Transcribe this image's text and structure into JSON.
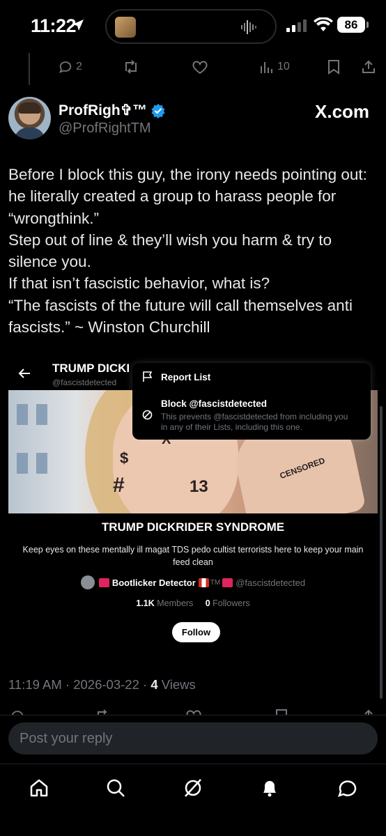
{
  "status_bar": {
    "time": "11:22",
    "battery": "86"
  },
  "prev_tweet_actions": {
    "replies": "2",
    "views": "10"
  },
  "author": {
    "display_name": "ProfRigh✞™",
    "handle": "@ProfRightTM"
  },
  "source_watermark": "X.com",
  "tweet": {
    "text": "Before I block this guy, the irony needs pointing out: he literally created a group to harass people for “wrongthink.”\nStep out of line & they’ll wish you harm & try to silence you.\nIf that isn’t fascistic behavior, what is?\n“The fascists of the future will call themselves anti fascists.” ~ Winston Churchill",
    "timestamp": "11:19 AM · 2026-03-22 · ",
    "views_count": "4",
    "views_label": " Views"
  },
  "embedded_list": {
    "header_title": "TRUMP DICKRIDER SYNDROME",
    "header_handle": "@fascistdetected",
    "menu": {
      "report_label": "Report List",
      "block_label": "Block @fascistdetected",
      "block_description": "This prevents @fascistdetected from including you in any of their Lists, including this one."
    },
    "name": "TRUMP DICKRIDER SYNDROME",
    "description": "Keep eyes on these mentally ill magat TDS pedo cultist terrorists here to keep your main feed clean",
    "owner_name": "Bootlicker Detector",
    "owner_tm": "TM",
    "owner_handle": "@fascistdetected",
    "members_count": "1.1K",
    "members_label": " Members",
    "followers_count": "0",
    "followers_label": " Followers",
    "follow_label": "Follow",
    "banner_tattoos": [
      "$",
      "13",
      "#",
      "CENSORED",
      "X"
    ]
  },
  "reply": {
    "placeholder": "Post your reply"
  },
  "icons": {
    "status": [
      "location-arrow-icon",
      "signal-icon",
      "wifi-icon",
      "battery-icon"
    ],
    "actions": [
      "reply-icon",
      "repost-icon",
      "like-icon",
      "views-icon",
      "bookmark-icon",
      "share-icon"
    ],
    "nav": [
      "home-icon",
      "search-icon",
      "grok-icon",
      "notifications-icon",
      "messages-icon"
    ]
  },
  "colors": {
    "background": "#000000",
    "text": "#e7e9ea",
    "secondary": "#71767b",
    "verified": "#1d9bf0",
    "follow_button": "#ffffff"
  }
}
